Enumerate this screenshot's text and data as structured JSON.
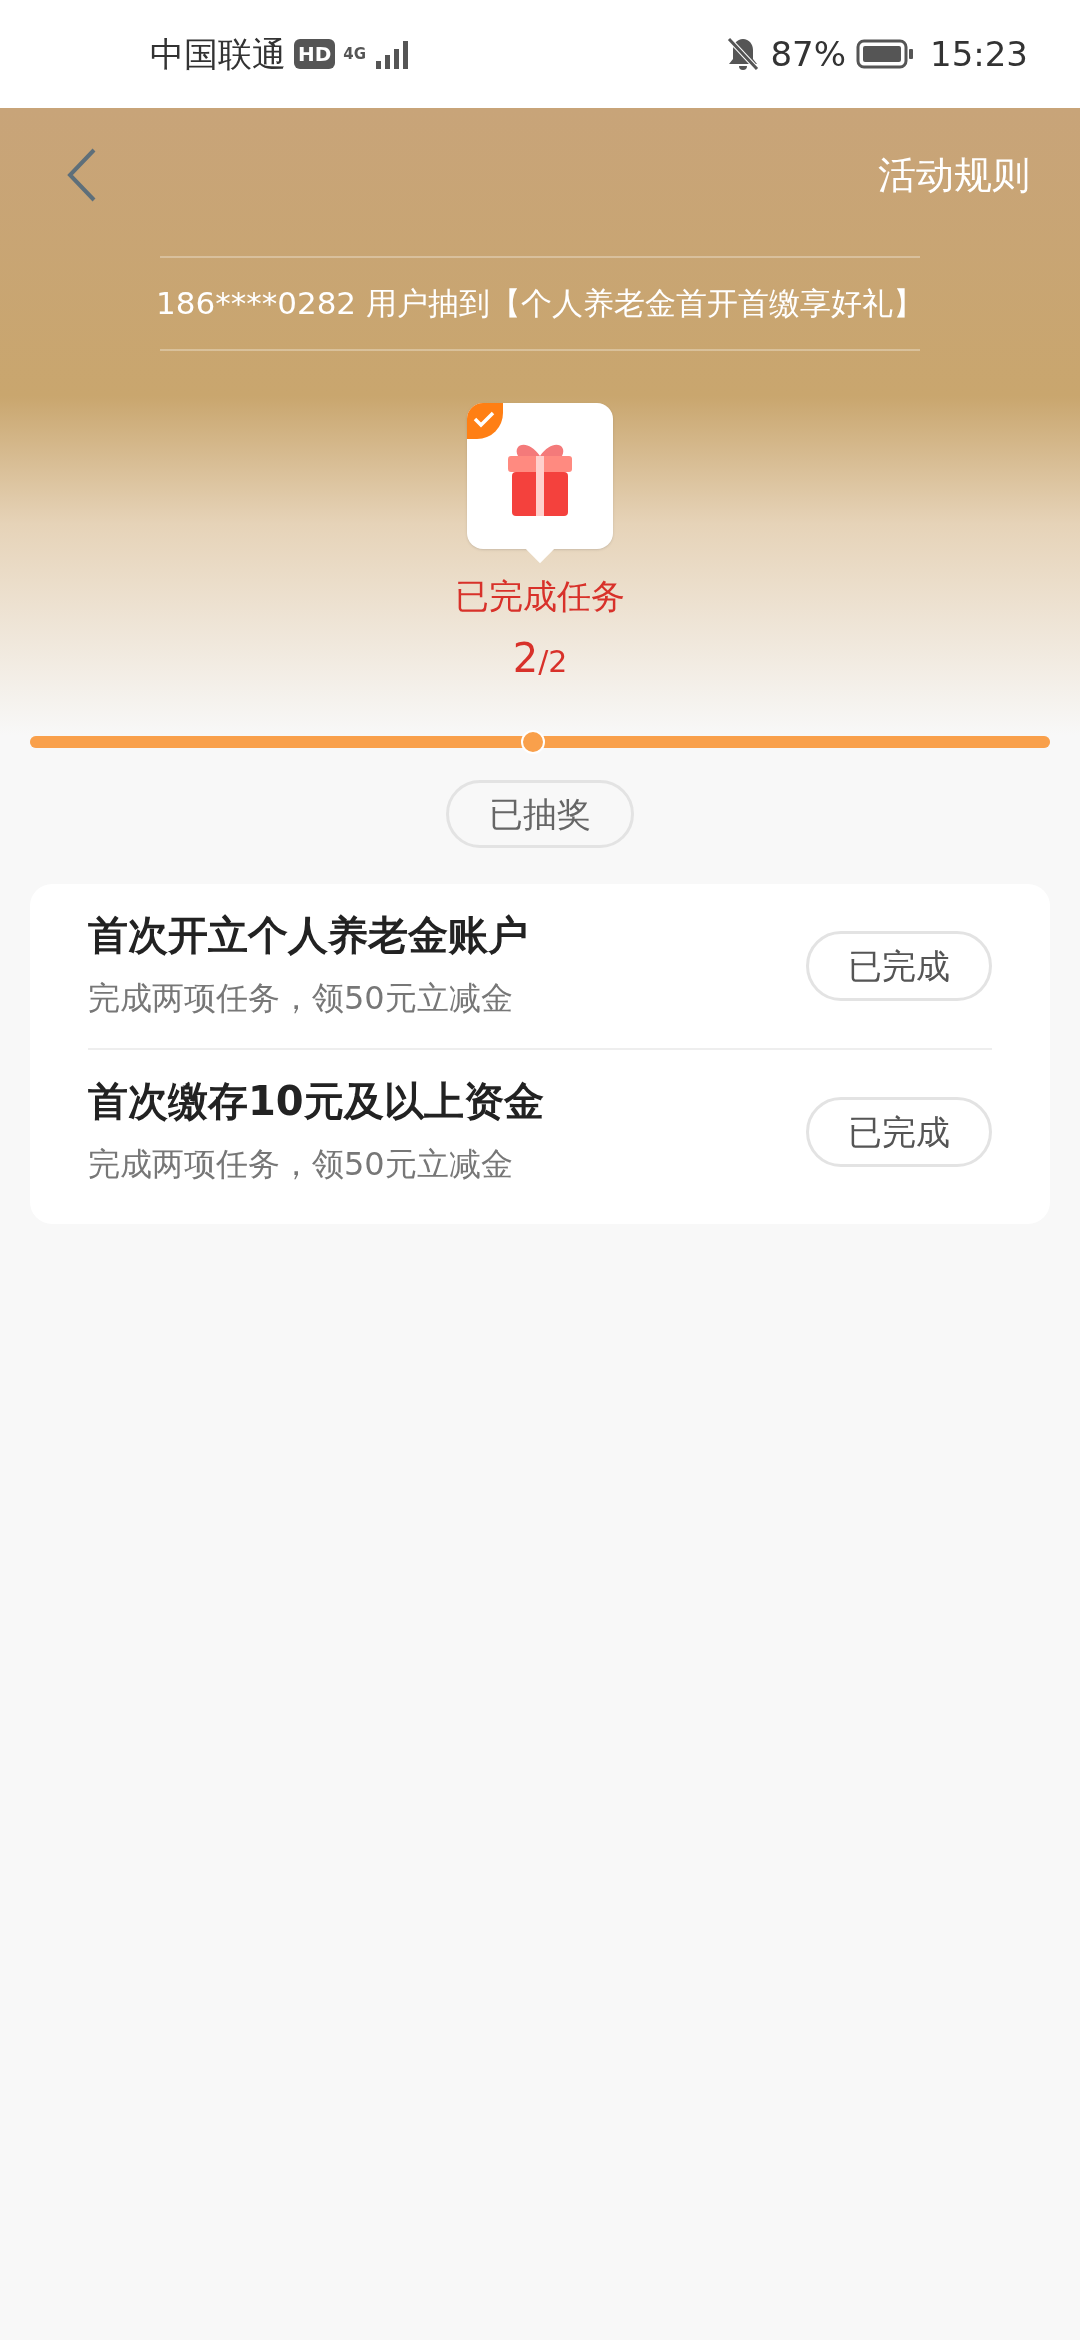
{
  "status_bar": {
    "carrier": "中国联通",
    "hd": "HD",
    "network": "4G",
    "battery": "87%",
    "time": "15:23",
    "muted": true
  },
  "header": {
    "rules_link": "活动规则",
    "ticker": "186****0282 用户抽到【个人养老金首开首缴享好礼】"
  },
  "milestone": {
    "checked": true,
    "label": "已完成任务",
    "count": "2",
    "total": "/2"
  },
  "progress": {
    "level": 1
  },
  "draw_button": {
    "label": "已抽奖",
    "disabled": true
  },
  "tasks": [
    {
      "title": "首次开立个人养老金账户",
      "subtitle": "完成两项任务，领50元立减金",
      "button": "已完成",
      "done": true
    },
    {
      "title": "首次缴存10元及以上资金",
      "subtitle": "完成两项任务，领50元立减金",
      "button": "已完成",
      "done": true
    }
  ]
}
